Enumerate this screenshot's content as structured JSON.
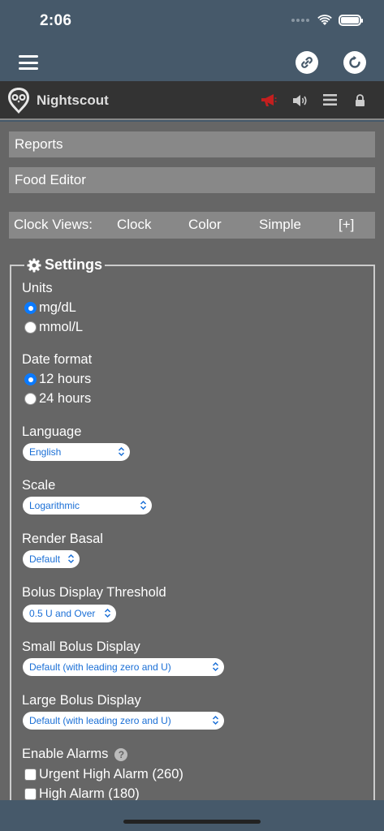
{
  "status_bar": {
    "time": "2:06"
  },
  "header": {
    "title": "Nightscout"
  },
  "menu": {
    "reports": "Reports",
    "food_editor": "Food Editor",
    "clock_views_label": "Clock Views:",
    "clock": "Clock",
    "color": "Color",
    "simple": "Simple",
    "add": "[+]"
  },
  "settings": {
    "title": "Settings",
    "units": {
      "label": "Units",
      "options": [
        "mg/dL",
        "mmol/L"
      ],
      "selected": "mg/dL"
    },
    "date_format": {
      "label": "Date format",
      "options": [
        "12 hours",
        "24 hours"
      ],
      "selected": "12 hours"
    },
    "language": {
      "label": "Language",
      "value": "English"
    },
    "scale": {
      "label": "Scale",
      "value": "Logarithmic"
    },
    "render_basal": {
      "label": "Render Basal",
      "value": "Default"
    },
    "bolus_threshold": {
      "label": "Bolus Display Threshold",
      "value": "0.5 U and Over"
    },
    "small_bolus": {
      "label": "Small Bolus Display",
      "value": "Default (with leading zero and U)"
    },
    "large_bolus": {
      "label": "Large Bolus Display",
      "value": "Default (with leading zero and U)"
    },
    "alarms": {
      "label": "Enable Alarms",
      "help": "?",
      "items": [
        "Urgent High Alarm (260)",
        "High Alarm (180)"
      ]
    }
  },
  "icons": [
    "menu-icon",
    "link-icon",
    "refresh-icon",
    "owl-logo-icon",
    "megaphone-icon",
    "speaker-icon",
    "list-icon",
    "lock-icon",
    "gear-icon",
    "help-icon"
  ],
  "colors": {
    "status_bar": "#46596a",
    "content_bg": "#666666",
    "menu_bar": "#888888",
    "header": "#333333",
    "accent": "#0a7aff"
  }
}
